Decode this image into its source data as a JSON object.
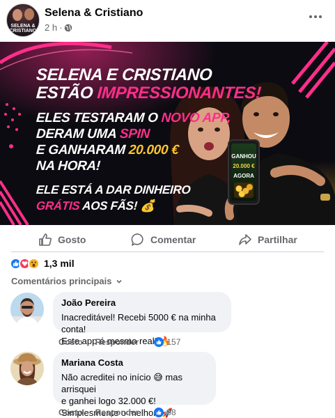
{
  "post": {
    "page_name": "Selena & Cristiano",
    "avatar_caption_1": "SELENA &",
    "avatar_caption_2": "CRISTIANO",
    "time": "2 h",
    "separator": "·"
  },
  "banner": {
    "line1": "SELENA E CRISTIANO",
    "line2a": "ESTÃO ",
    "line2b": "IMPRESSIONANTES!",
    "line3a": "ELES TESTARAM O ",
    "line3b": "NOVO APP,",
    "line4a": "DERAM UMA ",
    "line4b": "SPIN",
    "line5a": "E GANHARAM ",
    "line5b": "20.000 €",
    "line6": "NA HORA!",
    "line7": "ELE ESTÁ A DAR DINHEIRO",
    "line8a": "GRÁTIS",
    "line8b": " AOS FÃS! 💰",
    "phone_line1": "GANHOU",
    "phone_line2": "20.000 €",
    "phone_line3": "AGORA"
  },
  "actions": {
    "like": "Gosto",
    "comment": "Comentar",
    "share": "Partilhar"
  },
  "reactions": {
    "count": "1,3 mil"
  },
  "comments_sort": "Comentários principais",
  "comments": [
    {
      "name": "João Pereira",
      "line1": "Inacreditável! Recebi 5000 € na minha conta!",
      "line2": "Este app é mesmo real! 🔥",
      "like_label": "Gosto",
      "reply_label": "Responder",
      "likes": "157"
    },
    {
      "name": "Mariana Costa",
      "line1": "Não acreditei no início 😅 mas arrisquei",
      "line2": "e ganhei logo 32.000 €!",
      "line3": "Simplesmente o melhor! 🚀",
      "like_label": "Gosto",
      "reply_label": "Responder",
      "likes": "98"
    }
  ],
  "colors": {
    "accent_blue": "#1877f2",
    "pink": "#ff2e8a",
    "gold": "#ffc52e",
    "secondary_text": "#65676b"
  }
}
